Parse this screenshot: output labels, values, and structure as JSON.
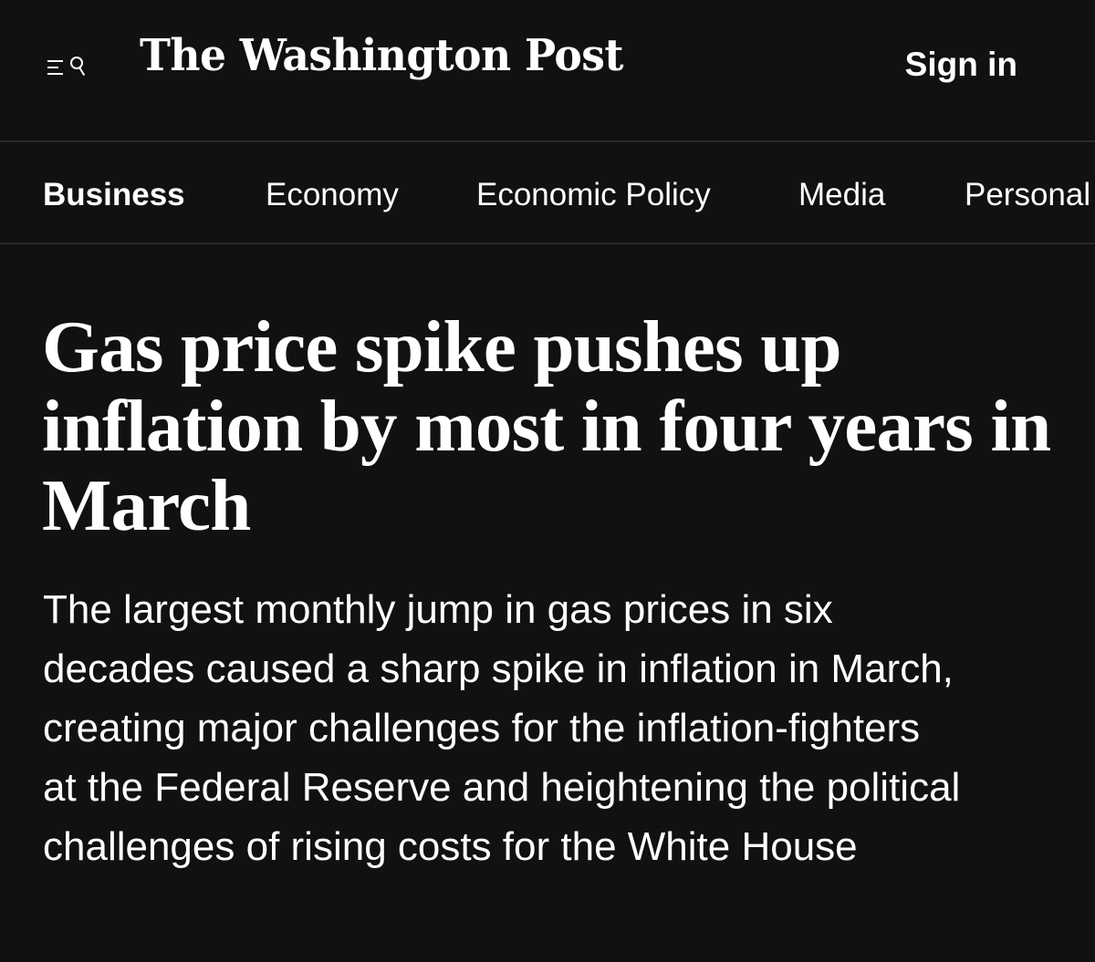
{
  "header": {
    "menu_icon": "hamburger-search-icon",
    "masthead": "The Washington Post",
    "sign_in_label": "Sign in"
  },
  "section_nav": {
    "items": [
      {
        "label": "Business",
        "active": true
      },
      {
        "label": "Economy",
        "active": false
      },
      {
        "label": "Economic Policy",
        "active": false
      },
      {
        "label": "Media",
        "active": false
      },
      {
        "label": "Personal",
        "active": false
      }
    ]
  },
  "article": {
    "headline": "Gas price spike pushes up inflation by most in four years in March",
    "dek": "The largest monthly jump in gas prices in six decades caused a sharp spike in inflation in March, creating major challenges for the inflation-fighters at the Federal Reserve and heightening the political challenges of rising costs for the White House"
  },
  "colors": {
    "background": "#111111",
    "text": "#ffffff",
    "divider": "#2a2a2a"
  }
}
